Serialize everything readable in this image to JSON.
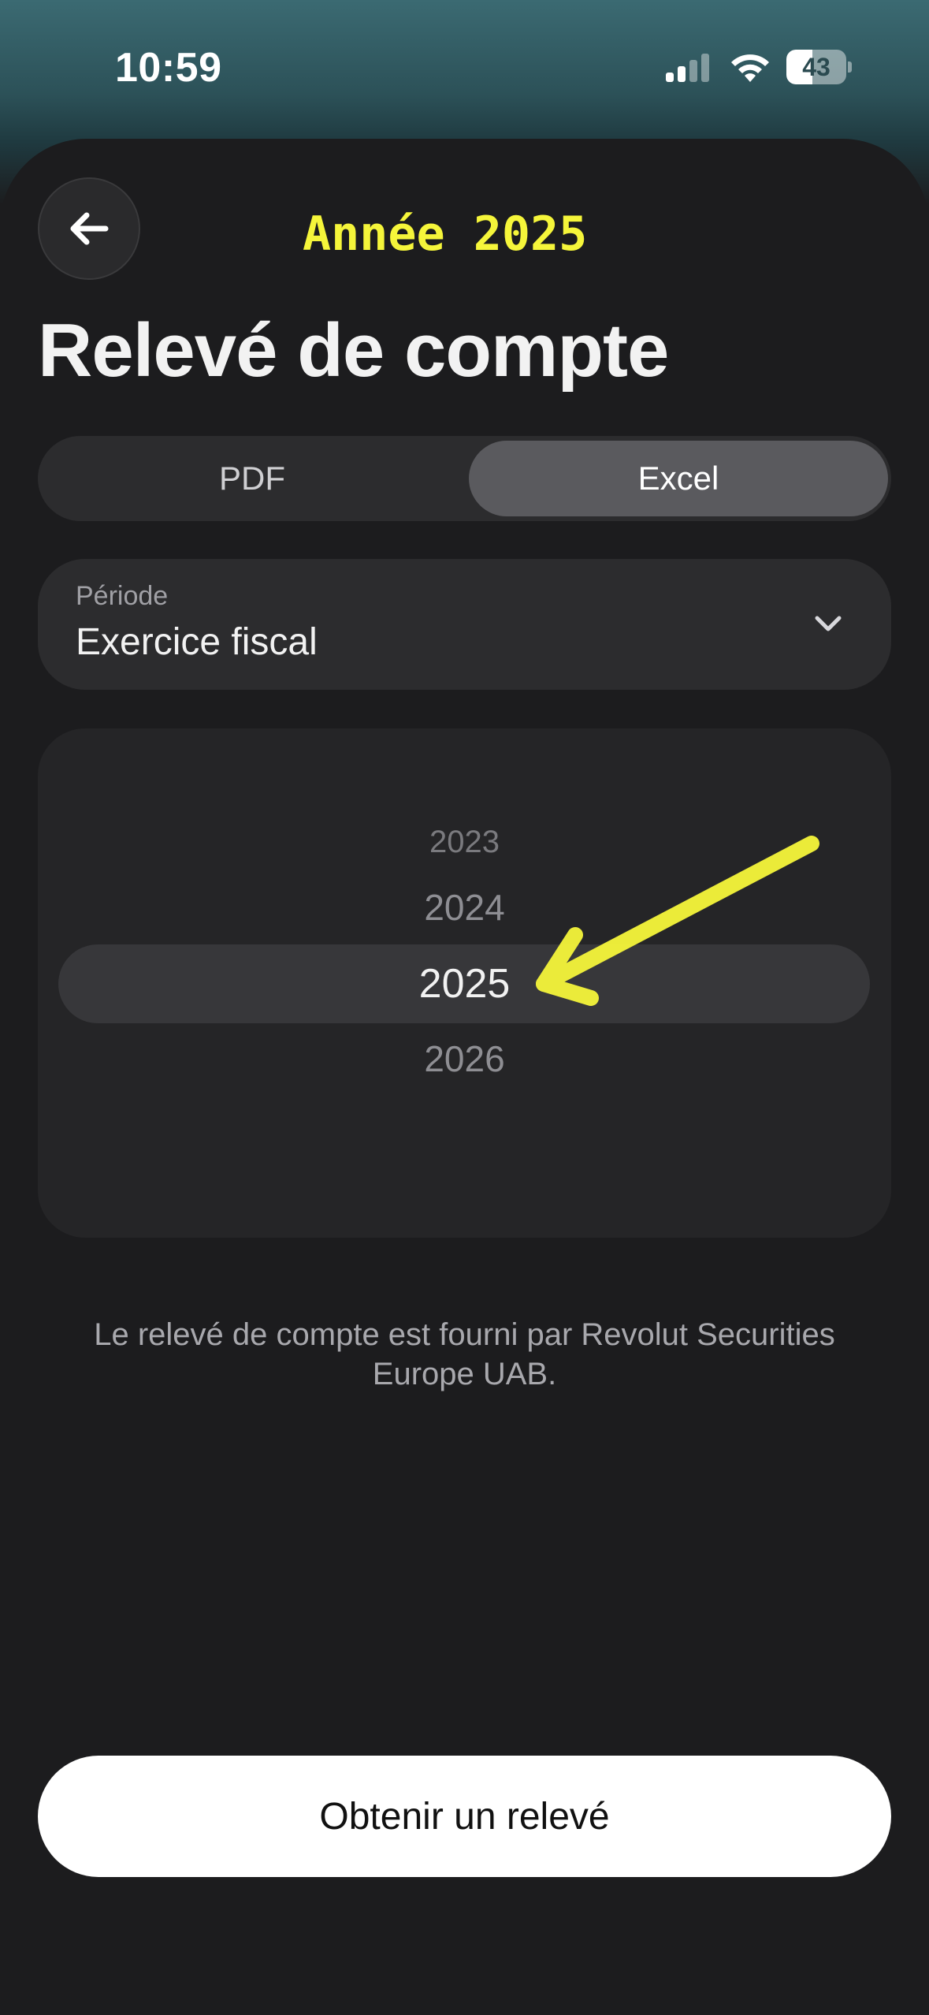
{
  "status_bar": {
    "time": "10:59",
    "battery_level": "43",
    "battery_fraction": 0.43,
    "icons": [
      "signal-icon",
      "wifi-icon",
      "battery-icon"
    ]
  },
  "annotation": {
    "title": "Année 2025",
    "color": "#f5f53a",
    "arrow_icon": "arrow-annotation-icon"
  },
  "header": {
    "back_icon": "arrow-left-icon",
    "title": "Relevé de compte"
  },
  "format_toggle": {
    "options": [
      "PDF",
      "Excel"
    ],
    "selected": "Excel"
  },
  "period": {
    "label": "Période",
    "value": "Exercice fiscal",
    "icon": "chevron-down-icon"
  },
  "year_picker": {
    "years": [
      "2023",
      "2024",
      "2025",
      "2026"
    ],
    "selected": "2025"
  },
  "footnote": "Le relevé de compte est fourni par Revolut Securities Europe UAB.",
  "cta": {
    "label": "Obtenir un relevé"
  },
  "colors": {
    "background": "#1c1c1e",
    "surface": "#2c2c2e",
    "selected_segment": "#5a5a5e",
    "cta_background": "#ffffff"
  }
}
